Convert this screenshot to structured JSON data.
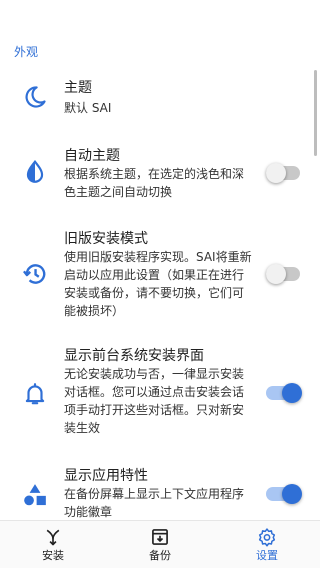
{
  "colors": {
    "accent": "#2f6fd6",
    "text": "#212121",
    "switch_off": "#c8c8c8"
  },
  "section": {
    "title": "外观"
  },
  "prefs": [
    {
      "title": "主题",
      "summary": "默认 SAI",
      "icon": "moon-icon"
    },
    {
      "title": "自动主题",
      "summary": "根据系统主题，在选定的浅色和深色主题之间自动切换",
      "icon": "contrast-drop-icon",
      "switch": "off"
    },
    {
      "title": "旧版安装模式",
      "summary": "使用旧版安装程序实现。SAI将重新启动以应用此设置（如果正在进行安装或备份，请不要切换，它们可能被损坏）",
      "icon": "history-icon",
      "switch": "off"
    },
    {
      "title": "显示前台系统安装界面",
      "summary": "无论安装成功与否，一律显示安装对话框。您可以通过点击安装会话项手动打开这些对话框。只对新安装生效",
      "icon": "bell-icon",
      "switch": "on"
    },
    {
      "title": "显示应用特性",
      "summary": "在备份屏幕上显示上下文应用程序功能徽章",
      "icon": "shapes-icon",
      "switch": "on"
    }
  ],
  "nav": [
    {
      "label": "安装",
      "icon": "install-icon"
    },
    {
      "label": "备份",
      "icon": "backup-icon"
    },
    {
      "label": "设置",
      "icon": "settings-gear-icon",
      "active": true
    }
  ]
}
